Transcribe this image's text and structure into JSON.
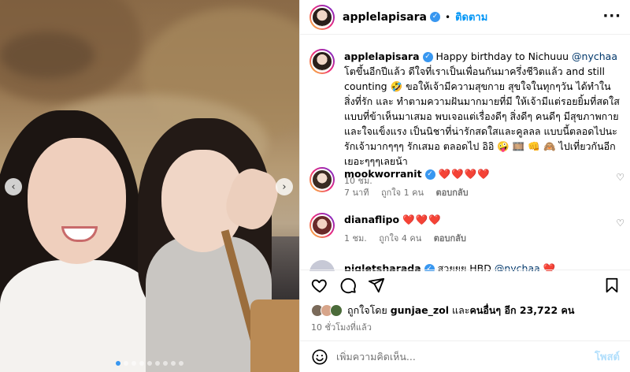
{
  "media": {
    "slide_count": 9,
    "active_index": 0
  },
  "post": {
    "username": "applelapisara",
    "header_sep": "•",
    "follow_label": "ติดตาม",
    "more_icon": "more-icon",
    "caption_parts": {
      "intro": "Happy birthday to Nichuuu ",
      "mention": "@nychaa",
      "rest": " โตขึ้นอีกปีแล้ว ดีใจที่เราเป็นเพื่อนกันมาครึ่งชีวิตแล้ว and still counting 🤣 ขอให้เจ้ามีความสุขกาย สุขใจในทุกๆวัน ได้ทำในสิ่งที่รัก และ ทำตามความฝันมากมายที่มี ให้เจ้ามีแต่รอยยิ้มที่สดใส แบบที่ข้าเห็นมาเสมอ พบเจอแต่เรื่องดีๆ สิ่งดีๆ คนดีๆ มีสุขภาพกายและใจแข็งแรง เป็นนิชาที่น่ารักสดใสและคูลลล แบบนี้ตลอดไปนะ รักเจ้ามากๆๆๆ รักเสมอ ตลอดไป อิอิ 🤪 🎞️ 👊 🙈 ไปเที่ยวกันอีกเยอะๆๆๆเลยน้า"
    },
    "caption_time": "10 ชม."
  },
  "comments": [
    {
      "username": "mookworranit",
      "text": "❤️❤️❤️❤️",
      "time": "7 นาที",
      "likes": "ถูกใจ 1 คน",
      "reply": "ตอบกลับ"
    },
    {
      "username": "dianaflipo",
      "text": "❤️❤️❤️",
      "time": "1 ชม.",
      "likes": "ถูกใจ 4 คน",
      "reply": "ตอบกลับ"
    },
    {
      "username": "pigletsharada",
      "text": "สวยยย HBD ",
      "mention": "@nychaa",
      "emoji": "❤️"
    }
  ],
  "actions": {
    "like_icon": "heart-icon",
    "comment_icon": "comment-icon",
    "share_icon": "share-icon",
    "save_icon": "bookmark-icon"
  },
  "likes_summary": {
    "prefix": "ถูกใจโดย ",
    "user": "gunjae_zol",
    "middle": " และ",
    "others": "คนอื่นๆ อีก 23,722 คน"
  },
  "time_ago": "10 ชั่วโมงที่แล้ว",
  "composer": {
    "placeholder": "เพิ่มความคิดเห็น...",
    "post_label": "โพสต์"
  },
  "colors": {
    "accent": "#0095f6",
    "heart": "#e0245e",
    "muted": "#737373"
  }
}
